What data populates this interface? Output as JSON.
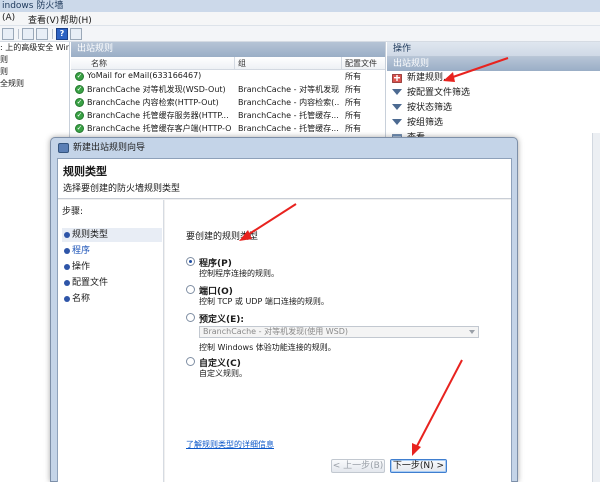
{
  "app": {
    "title": "indows 防火墙",
    "menu": [
      "(A)",
      "查看(V)",
      "帮助(H)"
    ]
  },
  "tree": {
    "items": [
      ": 上的高级安全 Wind",
      "则",
      "则",
      "全规则"
    ]
  },
  "center": {
    "header": "出站规则",
    "columns": [
      "名称",
      "组",
      "配置文件"
    ],
    "rows": [
      {
        "name": "YoMail for eMail(633166467)",
        "group": "",
        "profile": "所有"
      },
      {
        "name": "BranchCache 对等机发现(WSD-Out)",
        "group": "BranchCache - 对等机发现...",
        "profile": "所有"
      },
      {
        "name": "BranchCache 内容检索(HTTP-Out)",
        "group": "BranchCache - 内容检索(...",
        "profile": "所有"
      },
      {
        "name": "BranchCache 托管缓存服务器(HTTP...",
        "group": "BranchCache - 托管缓存...",
        "profile": "所有"
      },
      {
        "name": "BranchCache 托管缓存客户端(HTTP-O...",
        "group": "BranchCache - 托管缓存...",
        "profile": "所有"
      }
    ]
  },
  "actions": {
    "header": "操作",
    "sub": "出站规则",
    "items": [
      {
        "label": "新建规则...",
        "icon": "new-rule-icon"
      },
      {
        "label": "按配置文件筛选",
        "icon": "filter-icon"
      },
      {
        "label": "按状态筛选",
        "icon": "filter-icon"
      },
      {
        "label": "按组筛选",
        "icon": "filter-icon"
      },
      {
        "label": "查看",
        "icon": "view-icon"
      }
    ]
  },
  "dialog": {
    "title": "新建出站规则向导",
    "heading": "规则类型",
    "subheading": "选择要创建的防火墙规则类型",
    "steps_label": "步骤:",
    "steps": [
      "规则类型",
      "程序",
      "操作",
      "配置文件",
      "名称"
    ],
    "prompt": "要创建的规则类型",
    "options": [
      {
        "label": "程序(P)",
        "desc": "控制程序连接的规则。",
        "selected": true
      },
      {
        "label": "端口(O)",
        "desc": "控制 TCP 或 UDP 端口连接的规则。",
        "selected": false
      },
      {
        "label": "预定义(E):",
        "desc": "控制 Windows 体验功能连接的规则。",
        "selected": false
      },
      {
        "label": "自定义(C)",
        "desc": "自定义规则。",
        "selected": false
      }
    ],
    "predefined_value": "BranchCache - 对等机发现(使用 WSD)",
    "link": "了解规则类型的详细信息",
    "back_label": "< 上一步(B)",
    "next_label": "下一步(N) >"
  },
  "colors": {
    "annotation_red": "#e8231f",
    "accent_blue": "#2e55a8"
  }
}
